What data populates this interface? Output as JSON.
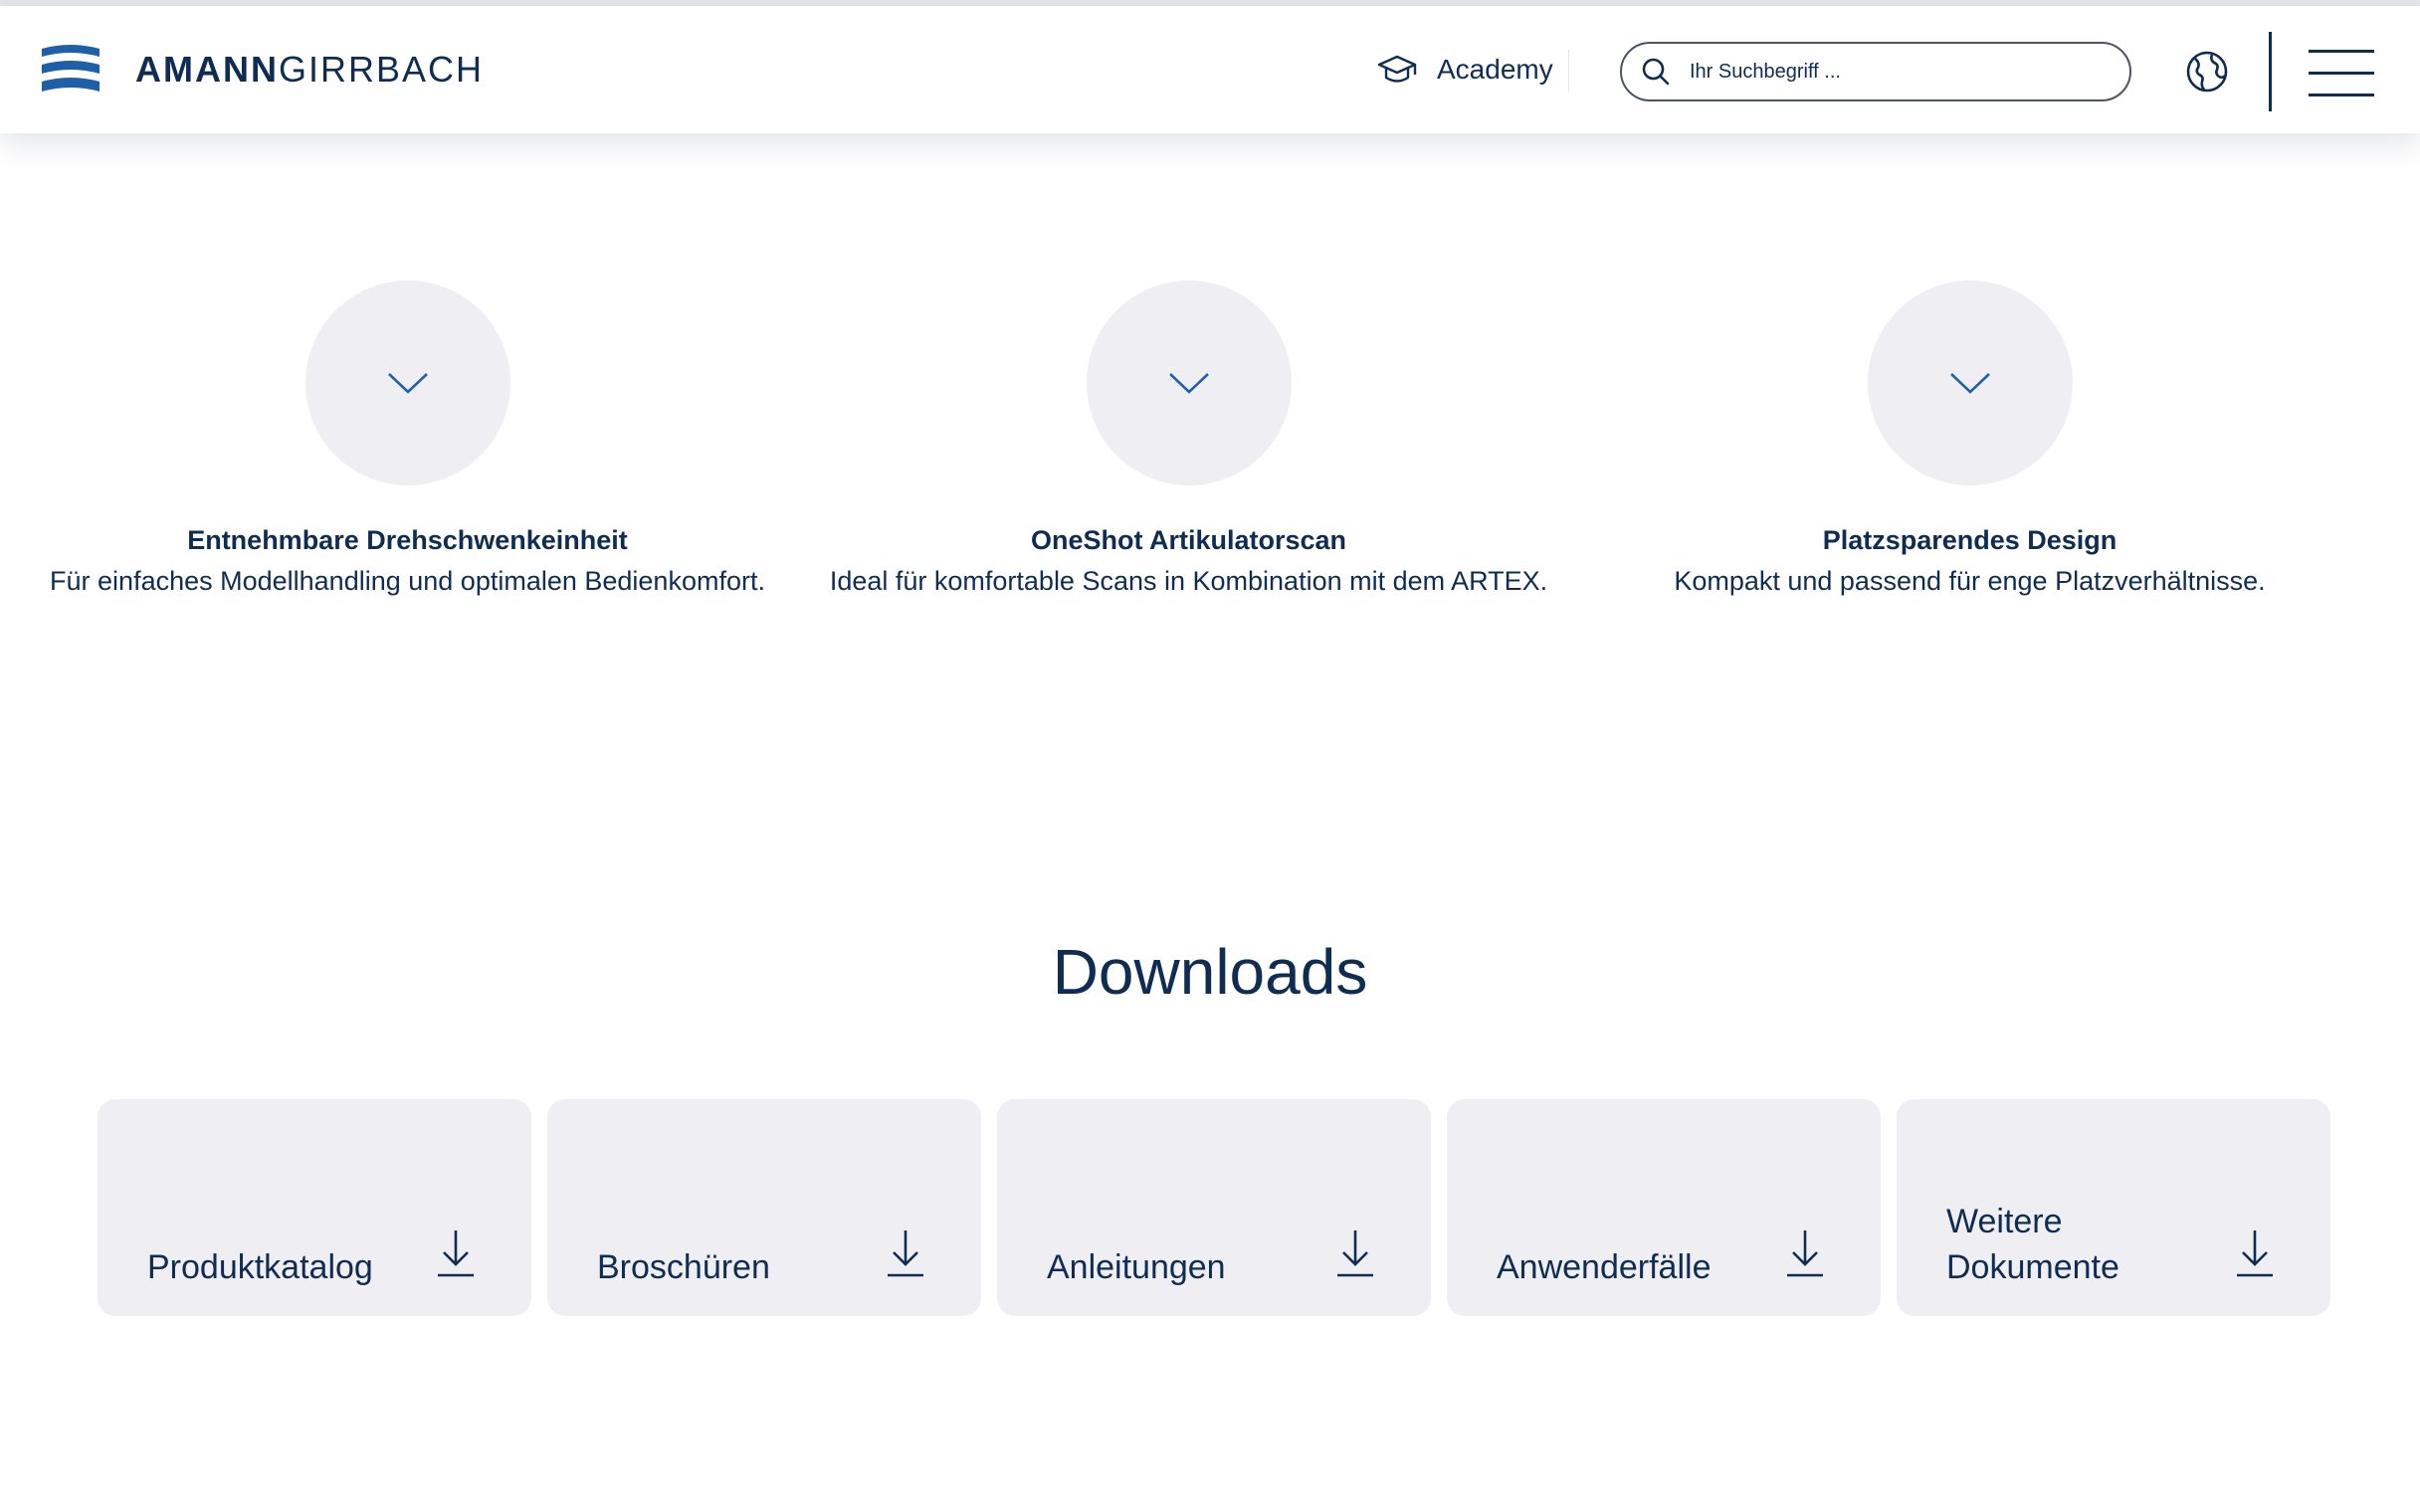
{
  "header": {
    "logo": {
      "bold": "AMANN",
      "light": "GIRRBACH",
      "icon": "amanngirrbach-logo-icon"
    },
    "academy": {
      "label": "Academy",
      "icon": "graduation-cap-icon"
    },
    "search": {
      "placeholder": "Ihr Suchbegriff ...",
      "value": "",
      "icon": "search-icon"
    },
    "language_icon": "globe-icon",
    "menu_icon": "hamburger-menu-icon"
  },
  "features": [
    {
      "title": "Entnehmbare Drehschwenkeinheit",
      "description": "Für einfaches Modellhandling und optimalen Bedienkomfort.",
      "icon": "chevron-down-icon"
    },
    {
      "title": "OneShot Artikulatorscan",
      "description": "Ideal für komfortable Scans in Kombination mit dem ARTEX.",
      "icon": "chevron-down-icon"
    },
    {
      "title": "Platzsparendes Design",
      "description": "Kompakt und passend für enge Platzverhältnisse.",
      "icon": "chevron-down-icon"
    }
  ],
  "downloads": {
    "title": "Downloads",
    "items": [
      {
        "label": "Produktkatalog",
        "icon": "download-icon"
      },
      {
        "label": "Broschüren",
        "icon": "download-icon"
      },
      {
        "label": "Anleitungen",
        "icon": "download-icon"
      },
      {
        "label": "Anwenderfälle",
        "icon": "download-icon"
      },
      {
        "label": "Weitere Dokumente",
        "icon": "download-icon"
      }
    ]
  },
  "colors": {
    "brand_navy": "#0f2d52",
    "brand_blue": "#1f5fa8",
    "card_background": "#eeeef3"
  }
}
